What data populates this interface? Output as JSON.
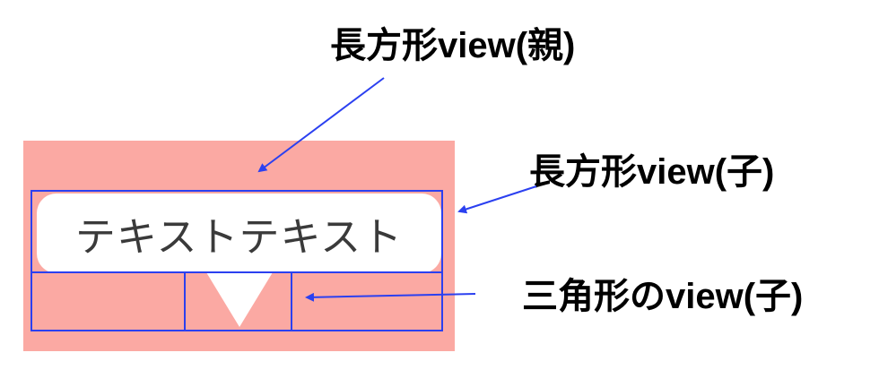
{
  "bubble": {
    "text": "テキストテキスト"
  },
  "labels": {
    "parent": "長方形view(親)",
    "child_rect": "長方形view(子)",
    "triangle": "三角形のview(子)"
  },
  "colors": {
    "parent_fill": "#fba9a3",
    "outline": "#2b40f0",
    "arrow": "#2b40f0",
    "bubble_fill": "#ffffff"
  }
}
